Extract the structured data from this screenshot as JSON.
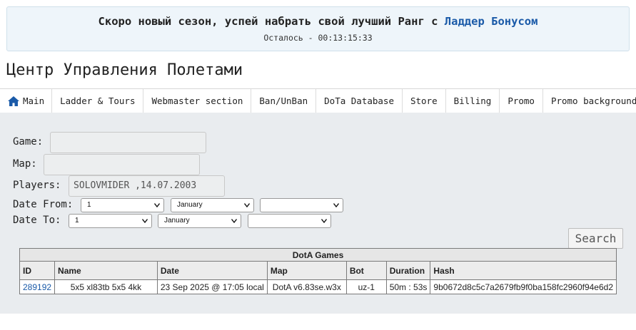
{
  "banner": {
    "text_prefix": "Скоро новый сезон, успей набрать свой лучший Ранг с",
    "link_text": "Ладдер Бонусом",
    "countdown": "Осталось - 00:13:15:33"
  },
  "page_title": "Центр Управления Полетами",
  "nav": {
    "items": [
      {
        "label": "Main",
        "icon": "home-icon"
      },
      {
        "label": "Ladder & Tours"
      },
      {
        "label": "Webmaster section"
      },
      {
        "label": "Ban/UnBan"
      },
      {
        "label": "DoTa Database"
      },
      {
        "label": "Store"
      },
      {
        "label": "Billing"
      },
      {
        "label": "Promo"
      },
      {
        "label": "Promo background"
      }
    ]
  },
  "form": {
    "game_label": "Game:",
    "game_value": "",
    "map_label": "Map:",
    "map_value": "",
    "players_label": "Players:",
    "players_value": "SOLOVMIDER ,14.07.2003",
    "date_from_label": "Date From:",
    "date_from": {
      "day": "1",
      "month": "January",
      "year": ""
    },
    "date_to_label": "Date To:",
    "date_to": {
      "day": "1",
      "month": "January",
      "year": ""
    },
    "search_label": "Search"
  },
  "games_table": {
    "caption": "DotA Games",
    "columns": [
      "ID",
      "Name",
      "Date",
      "Map",
      "Bot",
      "Duration",
      "Hash"
    ],
    "rows": [
      {
        "id": "289192",
        "name": "5x5 xl83tb 5x5 4kk",
        "date": "23 Sep 2025 @ 17:05 local",
        "map": "DotA v6.83se.w3x",
        "bot": "uz-1",
        "duration": "50m : 53s",
        "hash": "9b0672d8c5c7a2679fb9f0ba158fc2960f94e6d2"
      }
    ]
  },
  "colors": {
    "link": "#1a5aa8",
    "banner_bg": "#eef5fa",
    "content_bg": "#e9ecef"
  }
}
